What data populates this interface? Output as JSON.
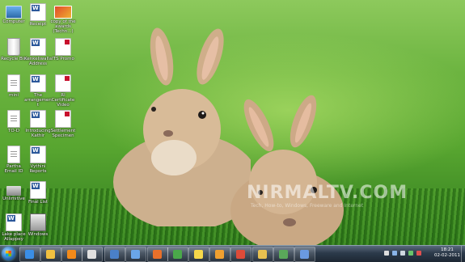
{
  "desktop_icons": [
    {
      "label": "Computer",
      "kind": "computer"
    },
    {
      "label": "Recycle Bin",
      "kind": "recycle"
    },
    {
      "label": "mini",
      "kind": "txt"
    },
    {
      "label": "TO-D",
      "kind": "txt"
    },
    {
      "label": "Partha Email ID",
      "kind": "txt"
    },
    {
      "label": "Unlimitive",
      "kind": "app"
    },
    {
      "label": "Lake place Allappey",
      "kind": "word"
    },
    {
      "label": "Receipt",
      "kind": "word"
    },
    {
      "label": "Kenkeliwalla Address",
      "kind": "word"
    },
    {
      "label": "The arrangement",
      "kind": "word"
    },
    {
      "label": "Introducing Kathir",
      "kind": "word"
    },
    {
      "label": "Vythini Reports",
      "kind": "word"
    },
    {
      "label": "Final List",
      "kind": "word"
    },
    {
      "label": "Windows",
      "kind": "app"
    },
    {
      "label": "copy of the awards (Techn...)",
      "kind": "img"
    },
    {
      "label": "ITS Promo",
      "kind": "pdf"
    },
    {
      "label": "RI Certificate Video",
      "kind": "pdf"
    },
    {
      "label": "Settlement Specimen",
      "kind": "pdf"
    }
  ],
  "watermark": {
    "title": "NIRMALTV.COM",
    "subtitle": "Tech, How-to, Windows, Freeware and Internet"
  },
  "taskbar": {
    "apps": [
      {
        "name": "internet-explorer",
        "color": "#3a8ee6"
      },
      {
        "name": "file-explorer",
        "color": "#f0c040"
      },
      {
        "name": "media-player",
        "color": "#f28a1a"
      },
      {
        "name": "hp-app",
        "color": "#e0e0e0"
      },
      {
        "name": "app-check",
        "color": "#4a80c8"
      },
      {
        "name": "app-blue-window",
        "color": "#6aa6e8"
      },
      {
        "name": "firefox",
        "color": "#e8702a"
      },
      {
        "name": "app-green",
        "color": "#4aa84a"
      },
      {
        "name": "sticky-notes",
        "color": "#f6d84a"
      },
      {
        "name": "outlook",
        "color": "#f0a030"
      },
      {
        "name": "chrome",
        "color": "#dd4b39"
      },
      {
        "name": "app-yellow-folder",
        "color": "#e8c050"
      },
      {
        "name": "app-green-tools",
        "color": "#5aa85a"
      },
      {
        "name": "app-network",
        "color": "#6a9ae0"
      }
    ],
    "clock_time": "18:21",
    "clock_date": "02-02-2011"
  }
}
